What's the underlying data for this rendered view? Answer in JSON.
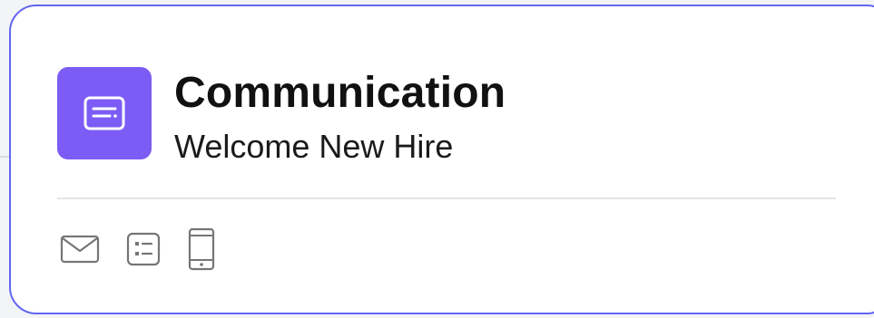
{
  "card": {
    "title": "Communication",
    "subtitle": "Welcome New Hire",
    "badge_icon": "message-card-icon",
    "accent_color": "#7c5cf5",
    "border_color": "#6366f1"
  },
  "actions": [
    {
      "icon": "email-icon"
    },
    {
      "icon": "form-list-icon"
    },
    {
      "icon": "mobile-icon"
    }
  ]
}
